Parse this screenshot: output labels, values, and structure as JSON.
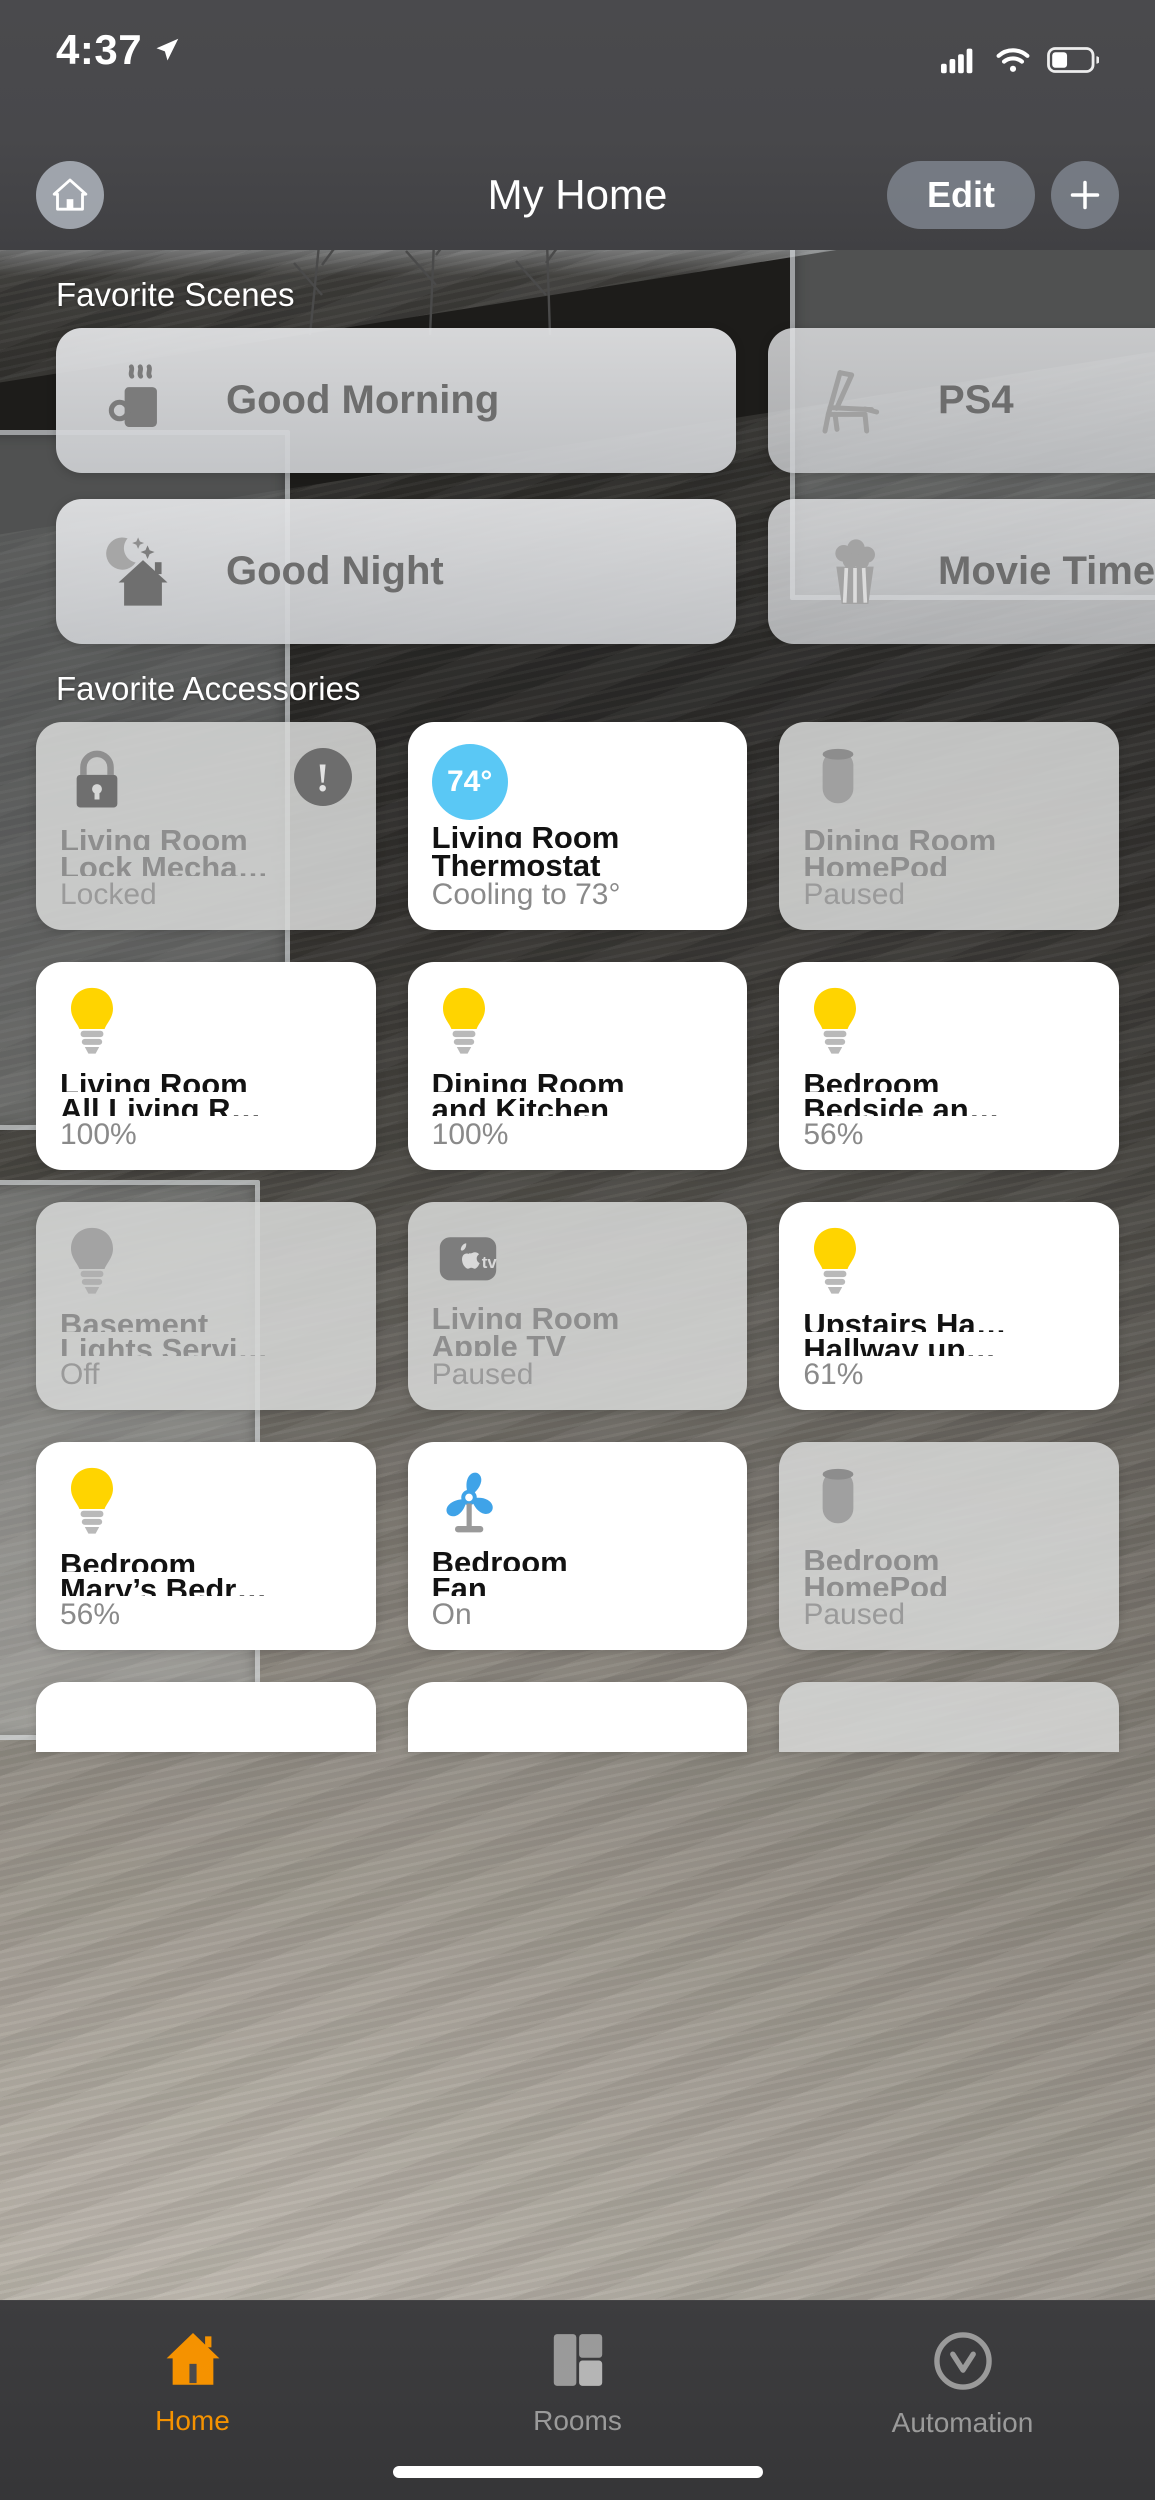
{
  "status_bar": {
    "time": "4:37",
    "location_icon": "location-arrow-icon",
    "cellular_icon": "cellular-bars-icon",
    "wifi_icon": "wifi-icon",
    "battery_icon": "battery-icon"
  },
  "nav": {
    "home_icon": "house-icon",
    "title": "My Home",
    "edit_label": "Edit",
    "add_icon": "plus-icon"
  },
  "sections": {
    "scenes_title": "Favorite Scenes",
    "accessories_title": "Favorite Accessories"
  },
  "scenes": [
    {
      "name": "Good Morning",
      "icon": "coffee-cup-icon",
      "state": "active"
    },
    {
      "name": "PS4",
      "icon": "lounge-chair-icon",
      "state": "dim"
    },
    {
      "name": "Good Night",
      "icon": "moon-stars-house-icon",
      "state": "active"
    },
    {
      "name": "Movie Time",
      "icon": "popcorn-icon",
      "state": "dim"
    }
  ],
  "accessories": [
    {
      "name_line1": "Living Room",
      "name_line2": "Lock Mecha…",
      "status": "Locked",
      "icon": "lock-icon",
      "on": false,
      "alert": true,
      "badge": "!"
    },
    {
      "name_line1": "Living Room",
      "name_line2": "Thermostat",
      "status": "Cooling to 73°",
      "icon": "temperature-badge",
      "on": true,
      "temp": "74°"
    },
    {
      "name_line1": "Dining Room",
      "name_line2": "HomePod",
      "status": "Paused",
      "icon": "homepod-icon",
      "on": false
    },
    {
      "name_line1": "Living Room",
      "name_line2": "All Living R…",
      "status": "100%",
      "icon": "lightbulb-icon",
      "on": true
    },
    {
      "name_line1": "Dining Room",
      "name_line2": "and Kitchen",
      "status": "100%",
      "icon": "lightbulb-icon",
      "on": true
    },
    {
      "name_line1": "Bedroom",
      "name_line2": "Bedside an…",
      "status": "56%",
      "icon": "lightbulb-icon",
      "on": true
    },
    {
      "name_line1": "Basement",
      "name_line2": "Lights Servi…",
      "status": "Off",
      "icon": "lightbulb-icon",
      "on": false
    },
    {
      "name_line1": "Living Room",
      "name_line2": "Apple TV",
      "status": "Paused",
      "icon": "apple-tv-icon",
      "on": false
    },
    {
      "name_line1": "Upstairs Ha…",
      "name_line2": "Hallway up…",
      "status": "61%",
      "icon": "lightbulb-icon",
      "on": true
    },
    {
      "name_line1": "Bedroom",
      "name_line2": "Mary’s Bedr…",
      "status": "56%",
      "icon": "lightbulb-icon",
      "on": true
    },
    {
      "name_line1": "Bedroom",
      "name_line2": "Fan",
      "status": "On",
      "icon": "fan-icon",
      "on": true
    },
    {
      "name_line1": "Bedroom",
      "name_line2": "HomePod",
      "status": "Paused",
      "icon": "homepod-icon",
      "on": false
    }
  ],
  "tabs": [
    {
      "label": "Home",
      "icon": "house-filled-icon",
      "active": true
    },
    {
      "label": "Rooms",
      "icon": "rooms-icon",
      "active": false
    },
    {
      "label": "Automation",
      "icon": "automation-icon",
      "active": false
    }
  ],
  "colors": {
    "accent": "#f59200",
    "thermostat_blue": "#5ac8f5",
    "bulb_yellow": "#ffd400"
  }
}
